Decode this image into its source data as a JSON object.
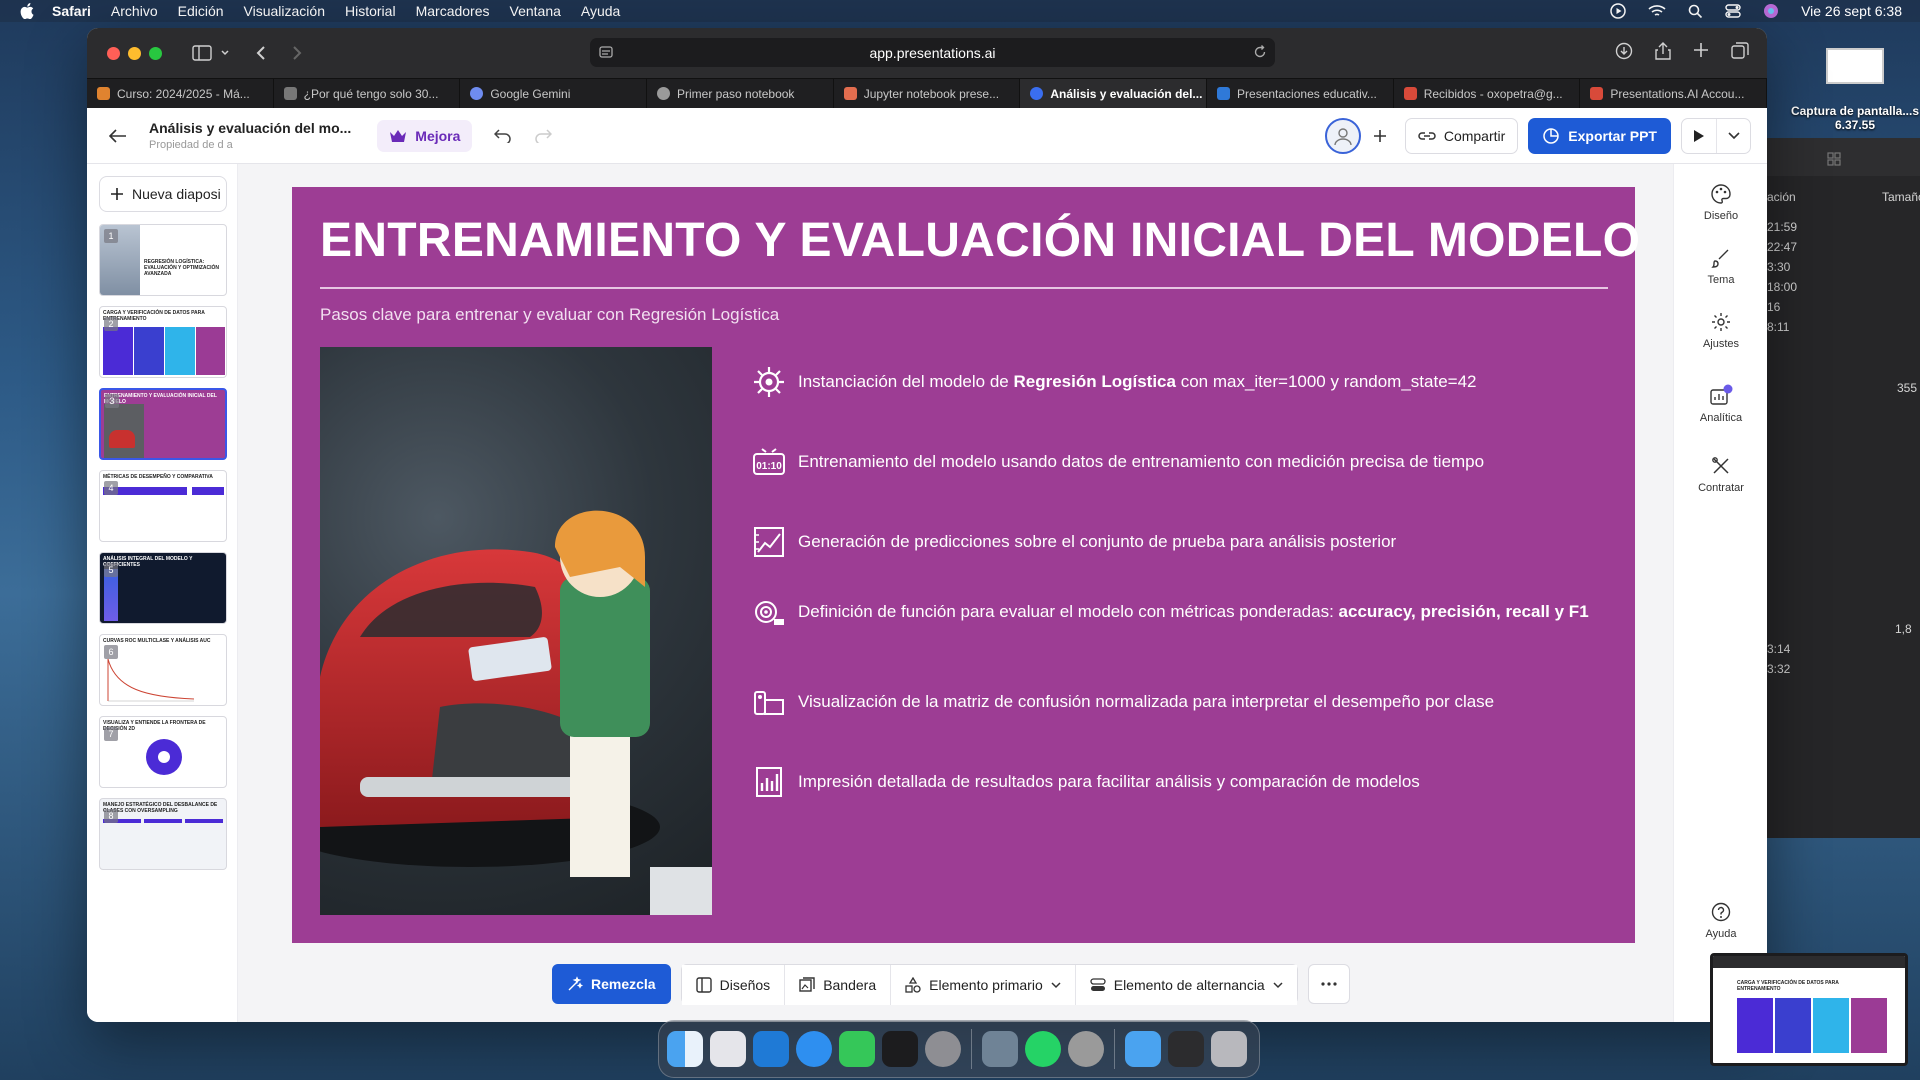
{
  "menubar": {
    "app": "Safari",
    "items": [
      "Archivo",
      "Edición",
      "Visualización",
      "Historial",
      "Marcadores",
      "Ventana",
      "Ayuda"
    ],
    "datetime": "Vie 26 sept 6:38"
  },
  "browser": {
    "url": "app.presentations.ai",
    "tabs": [
      {
        "label": "Curso: 2024/2025 - Má...",
        "color": "#e0832f"
      },
      {
        "label": "¿Por qué tengo solo 30...",
        "color": "#777777"
      },
      {
        "label": "Google Gemini",
        "color": "#6f8cf0"
      },
      {
        "label": "Primer paso notebook",
        "color": "#9a9a9a"
      },
      {
        "label": "Jupyter notebook prese...",
        "color": "#e26d4f"
      },
      {
        "label": "Análisis y evaluación del...",
        "color": "#3a6ef0",
        "active": true
      },
      {
        "label": "Presentaciones educativ...",
        "color": "#2f79d8"
      },
      {
        "label": "Recibidos - oxopetra@g...",
        "color": "#d84a3a"
      },
      {
        "label": "Presentations.AI Accou...",
        "color": "#d84a3a"
      }
    ]
  },
  "header": {
    "title": "Análisis y evaluación del mo...",
    "subtitle": "Propiedad de d a",
    "mejora": "Mejora",
    "share": "Compartir",
    "export": "Exportar PPT"
  },
  "left": {
    "new_slide": "Nueva diaposi",
    "thumbs": [
      {
        "num": "1",
        "title": "REGRESIÓN LOGÍSTICA: EVALUACIÓN Y OPTIMIZACIÓN AVANZADA"
      },
      {
        "num": "2",
        "title": "CARGA Y VERIFICACIÓN DE DATOS PARA ENTRENAMIENTO"
      },
      {
        "num": "3",
        "title": "ENTRENAMIENTO Y EVALUACIÓN INICIAL DEL MODELO"
      },
      {
        "num": "4",
        "title": "MÉTRICAS DE DESEMPEÑO Y COMPARATIVA"
      },
      {
        "num": "5",
        "title": "ANÁLISIS INTEGRAL DEL MODELO Y COEFICIENTES"
      },
      {
        "num": "6",
        "title": "CURVAS ROC MULTICLASE Y ANÁLISIS AUC"
      },
      {
        "num": "7",
        "title": "VISUALIZA Y ENTIENDE LA FRONTERA DE DECISIÓN 2D"
      },
      {
        "num": "8",
        "title": "MANEJO ESTRATÉGICO DEL DESBALANCE DE CLASES CON OVERSAMPLING"
      }
    ]
  },
  "slide": {
    "title": "ENTRENAMIENTO Y EVALUACIÓN INICIAL DEL MODELO",
    "subtitle": "Pasos clave para entrenar y evaluar con Regresión Logística",
    "bg_color": "#9d3d94",
    "bullets": [
      {
        "icon": "gear-network-icon",
        "pre": "Instanciación del modelo de ",
        "bold": "Regresión Logística",
        "post": " con max_iter=1000 y random_state=42"
      },
      {
        "icon": "timer-icon",
        "pre": "Entrenamiento del modelo usando datos de entrenamiento con medición precisa de tiempo",
        "bold": "",
        "post": ""
      },
      {
        "icon": "chart-icon",
        "pre": "Generación de predicciones sobre el conjunto de prueba para análisis posterior",
        "bold": "",
        "post": ""
      },
      {
        "icon": "target-icon",
        "pre": "Definición de función para evaluar el modelo con métricas ponderadas: ",
        "bold": "accuracy, precisión, recall y F1",
        "post": ""
      },
      {
        "icon": "matrix-icon",
        "pre": "Visualización de la matriz de confusión normalizada para interpretar el desempeño por clase",
        "bold": "",
        "post": ""
      },
      {
        "icon": "report-icon",
        "pre": "Impresión detallada de resultados para facilitar análisis y comparación de modelos",
        "bold": "",
        "post": ""
      }
    ]
  },
  "bottom": {
    "remix": "Remezcla",
    "designs": "Diseños",
    "flag": "Bandera",
    "primary": "Elemento primario",
    "alt": "Elemento de alternancia"
  },
  "right": {
    "design": "Diseño",
    "theme": "Tema",
    "settings": "Ajustes",
    "analytics": "Analítica",
    "contract": "Contratar",
    "help": "Ayuda"
  },
  "desktop": {
    "screenshot_label": "Captura de pantalla...s 6.37.55",
    "finder_col1": "ación",
    "finder_col2": "Tamaño",
    "finder_times": [
      "21:59",
      "22:47",
      "3:30",
      "18:00",
      "16",
      "8:11"
    ],
    "finder_size1": "355",
    "finder_size2": "1,8",
    "finder_times2": [
      "3:14",
      "3:32"
    ],
    "preview_title": "CARGA Y VERIFICACIÓN DE DATOS PARA ENTRENAMIENTO"
  }
}
